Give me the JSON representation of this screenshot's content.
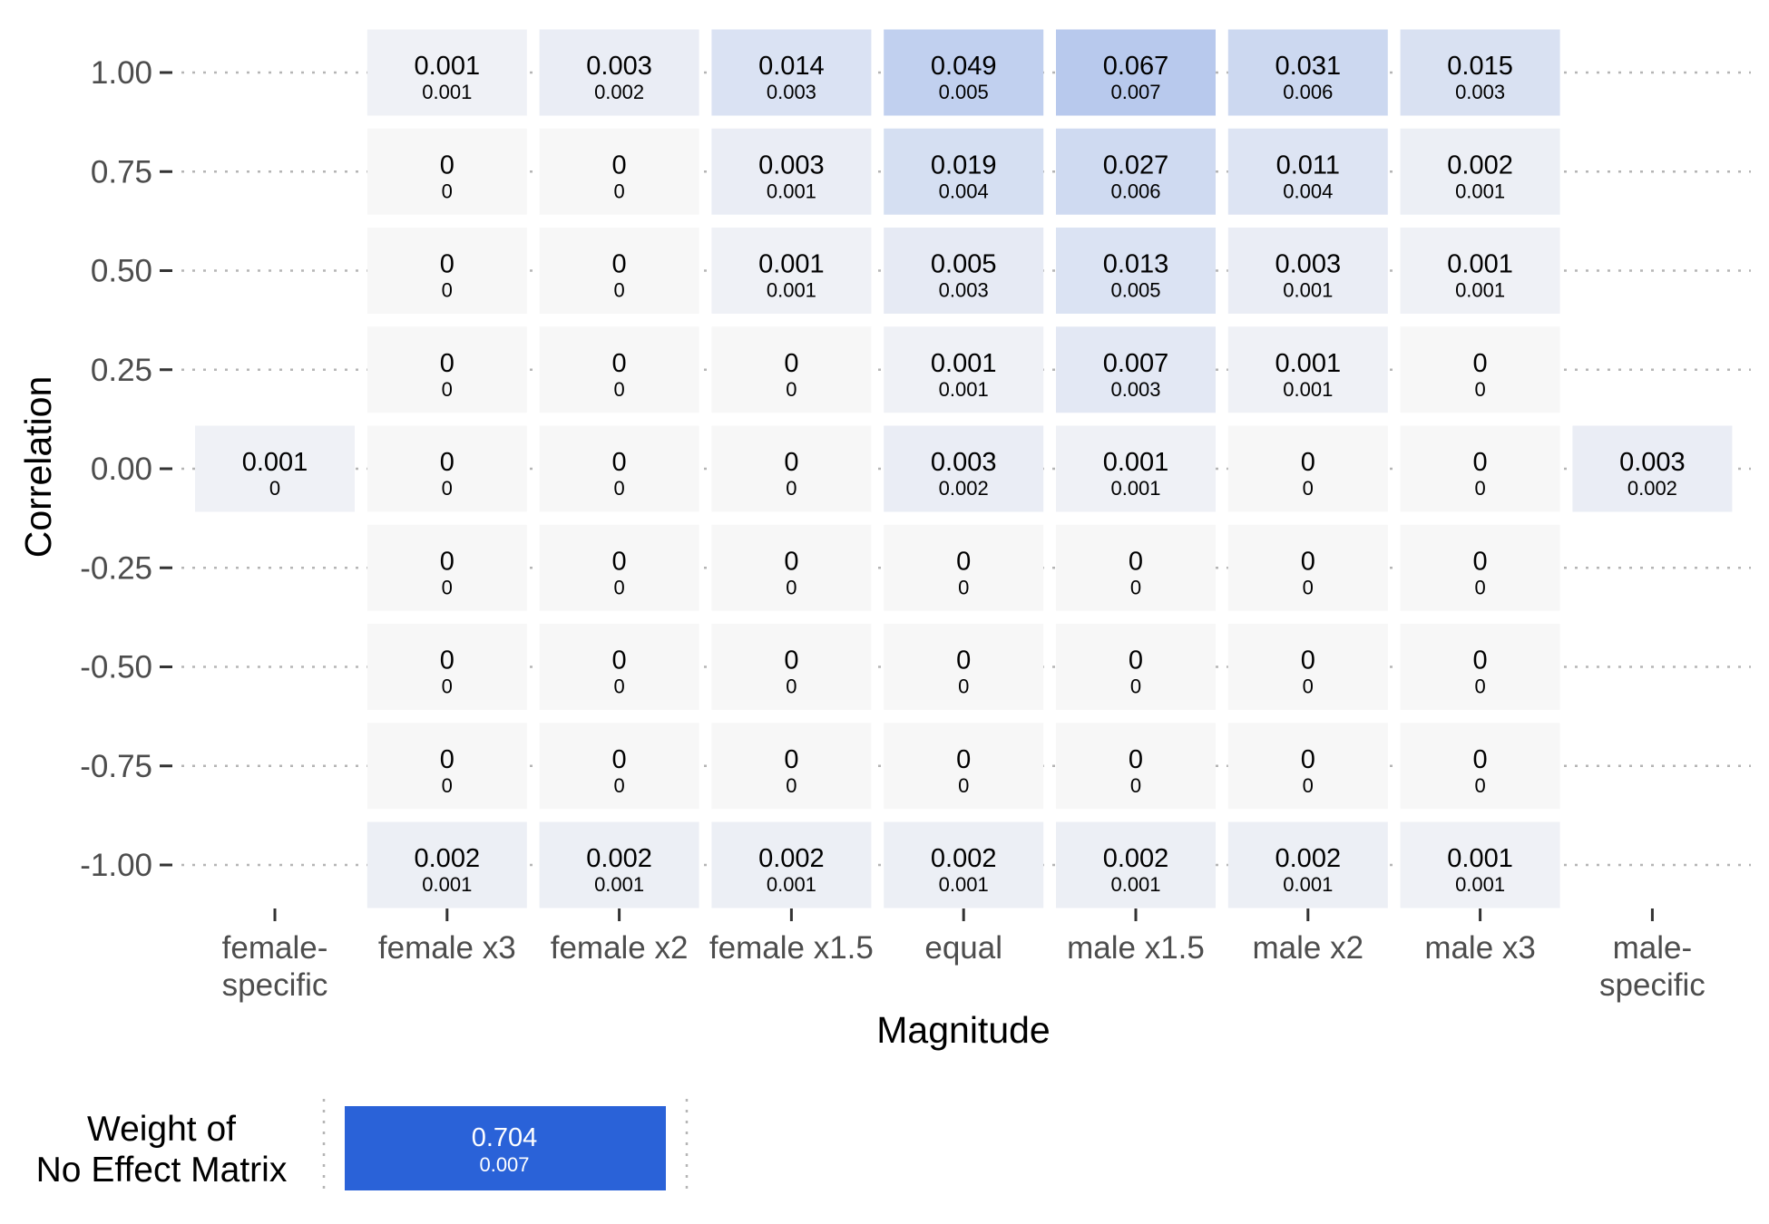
{
  "chart_data": {
    "type": "heatmap",
    "xlabel": "Magnitude",
    "ylabel": "Correlation",
    "x_categories": [
      "female-\nspecific",
      "female x3",
      "female x2",
      "female x1.5",
      "equal",
      "male x1.5",
      "male x2",
      "male x3",
      "male-\nspecific"
    ],
    "y_categories": [
      "1.00",
      "0.75",
      "0.50",
      "0.25",
      "0.00",
      "-0.25",
      "-0.50",
      "-0.75",
      "-1.00"
    ],
    "cells": [
      [
        null,
        {
          "v": "0.001",
          "se": "0.001"
        },
        {
          "v": "0.003",
          "se": "0.002"
        },
        {
          "v": "0.014",
          "se": "0.003"
        },
        {
          "v": "0.049",
          "se": "0.005"
        },
        {
          "v": "0.067",
          "se": "0.007"
        },
        {
          "v": "0.031",
          "se": "0.006"
        },
        {
          "v": "0.015",
          "se": "0.003"
        },
        null
      ],
      [
        null,
        {
          "v": "0",
          "se": "0"
        },
        {
          "v": "0",
          "se": "0"
        },
        {
          "v": "0.003",
          "se": "0.001"
        },
        {
          "v": "0.019",
          "se": "0.004"
        },
        {
          "v": "0.027",
          "se": "0.006"
        },
        {
          "v": "0.011",
          "se": "0.004"
        },
        {
          "v": "0.002",
          "se": "0.001"
        },
        null
      ],
      [
        null,
        {
          "v": "0",
          "se": "0"
        },
        {
          "v": "0",
          "se": "0"
        },
        {
          "v": "0.001",
          "se": "0.001"
        },
        {
          "v": "0.005",
          "se": "0.003"
        },
        {
          "v": "0.013",
          "se": "0.005"
        },
        {
          "v": "0.003",
          "se": "0.001"
        },
        {
          "v": "0.001",
          "se": "0.001"
        },
        null
      ],
      [
        null,
        {
          "v": "0",
          "se": "0"
        },
        {
          "v": "0",
          "se": "0"
        },
        {
          "v": "0",
          "se": "0"
        },
        {
          "v": "0.001",
          "se": "0.001"
        },
        {
          "v": "0.007",
          "se": "0.003"
        },
        {
          "v": "0.001",
          "se": "0.001"
        },
        {
          "v": "0",
          "se": "0"
        },
        null
      ],
      [
        {
          "v": "0.001",
          "se": "0"
        },
        {
          "v": "0",
          "se": "0"
        },
        {
          "v": "0",
          "se": "0"
        },
        {
          "v": "0",
          "se": "0"
        },
        {
          "v": "0.003",
          "se": "0.002"
        },
        {
          "v": "0.001",
          "se": "0.001"
        },
        {
          "v": "0",
          "se": "0"
        },
        {
          "v": "0",
          "se": "0"
        },
        {
          "v": "0.003",
          "se": "0.002"
        }
      ],
      [
        null,
        {
          "v": "0",
          "se": "0"
        },
        {
          "v": "0",
          "se": "0"
        },
        {
          "v": "0",
          "se": "0"
        },
        {
          "v": "0",
          "se": "0"
        },
        {
          "v": "0",
          "se": "0"
        },
        {
          "v": "0",
          "se": "0"
        },
        {
          "v": "0",
          "se": "0"
        },
        null
      ],
      [
        null,
        {
          "v": "0",
          "se": "0"
        },
        {
          "v": "0",
          "se": "0"
        },
        {
          "v": "0",
          "se": "0"
        },
        {
          "v": "0",
          "se": "0"
        },
        {
          "v": "0",
          "se": "0"
        },
        {
          "v": "0",
          "se": "0"
        },
        {
          "v": "0",
          "se": "0"
        },
        null
      ],
      [
        null,
        {
          "v": "0",
          "se": "0"
        },
        {
          "v": "0",
          "se": "0"
        },
        {
          "v": "0",
          "se": "0"
        },
        {
          "v": "0",
          "se": "0"
        },
        {
          "v": "0",
          "se": "0"
        },
        {
          "v": "0",
          "se": "0"
        },
        {
          "v": "0",
          "se": "0"
        },
        null
      ],
      [
        null,
        {
          "v": "0.002",
          "se": "0.001"
        },
        {
          "v": "0.002",
          "se": "0.001"
        },
        {
          "v": "0.002",
          "se": "0.001"
        },
        {
          "v": "0.002",
          "se": "0.001"
        },
        {
          "v": "0.002",
          "se": "0.001"
        },
        {
          "v": "0.002",
          "se": "0.001"
        },
        {
          "v": "0.001",
          "se": "0.001"
        },
        null
      ]
    ],
    "color_scale": {
      "low": "#f7f7f7",
      "high": "#2a62d8",
      "max": 0.704
    },
    "no_effect": {
      "label": "Weight of\nNo Effect Matrix",
      "v": "0.704",
      "se": "0.007"
    },
    "grid": "dotted horizontal"
  }
}
